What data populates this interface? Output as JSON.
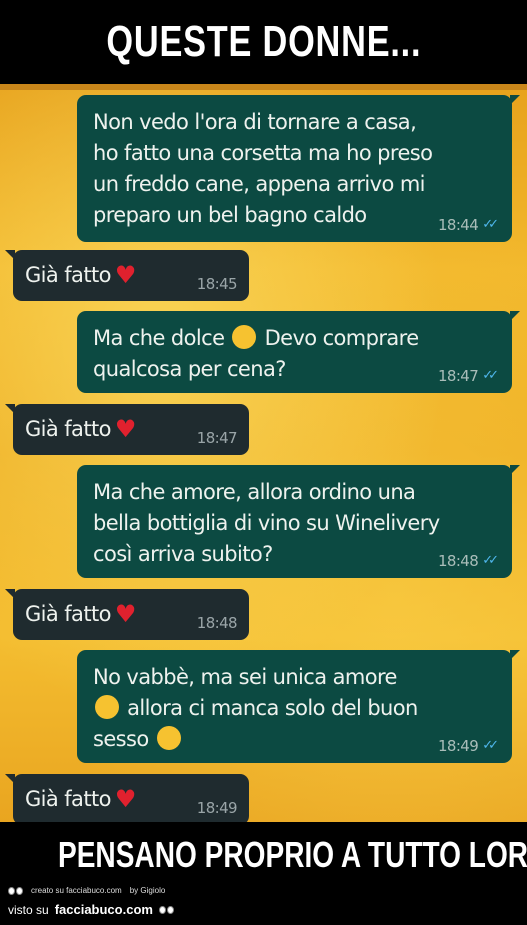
{
  "top_caption": "QUESTE DONNE...",
  "bottom_caption": "PENSANO PROPRIO A TUTTO LORO !",
  "messages": [
    {
      "text": "Non vedo l'ora di tornare a casa,\nho fatto una corsetta ma ho preso\nun freddo cane, appena arrivo mi\npreparo un bel bagno caldo",
      "time": "18:44"
    },
    {
      "text": "Già fatto",
      "time": "18:45"
    },
    {
      "text_a": "Ma che dolce",
      "text_b": "Devo comprare\nqualcosa per cena?",
      "time": "18:47"
    },
    {
      "text": "Già fatto",
      "time": "18:47"
    },
    {
      "text": "Ma che amore, allora ordino una\nbella bottiglia di vino su Winelivery\ncosì arriva subito?",
      "time": "18:48"
    },
    {
      "text": "Già fatto",
      "time": "18:48"
    },
    {
      "text_a": "No vabbè, ma sei unica amore",
      "text_b": "allora ci manca solo del buon",
      "text_c": "sesso",
      "time": "18:49"
    },
    {
      "text": "Già fatto",
      "time": "18:49"
    }
  ],
  "icons": {
    "heart": "red-heart-emoji",
    "kiss": "face-blowing-kiss-emoji",
    "heart_eyes": "heart-eyes-emoji",
    "smirk": "smirking-face-emoji",
    "read_ticks": "double-check-icon"
  },
  "colors": {
    "outgoing_bubble": "#0c4a42",
    "incoming_bubble": "#1f2b2f",
    "read_ticks": "#4fb6ec",
    "heart": "#e0212e"
  },
  "credit": {
    "created": "creato su facciabuco.com",
    "by": "by Gigiolo"
  },
  "watermark": {
    "prefix": "visto su",
    "site": "facciabuco.com"
  }
}
